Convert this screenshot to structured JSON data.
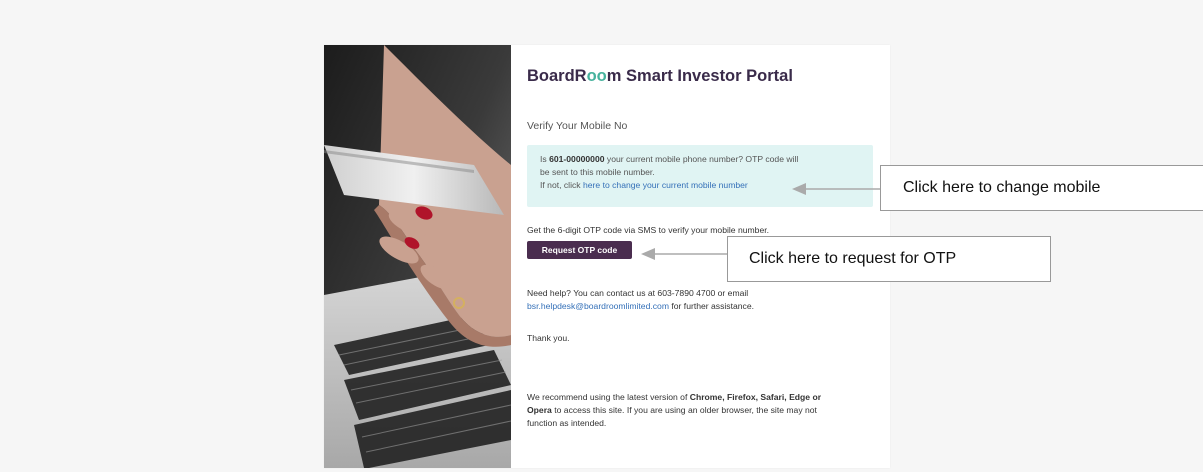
{
  "portal": {
    "brand_part1": "BoardR",
    "brand_accent": "oo",
    "brand_part2": "m Smart Investor Portal",
    "subtitle": "Verify Your Mobile No"
  },
  "info_box": {
    "line1_pre": "Is ",
    "phone": "601-00000000",
    "line1_post": " your current mobile phone number? OTP code will",
    "line2": "be sent to this mobile number.",
    "line3_pre": "If not, click ",
    "change_link": "here to change your current mobile number"
  },
  "otp": {
    "instruction": "Get the 6-digit OTP code via SMS to verify your mobile number.",
    "button_label": "Request OTP code"
  },
  "help": {
    "line1": "Need help? You can contact us at 603-7890 4700 or email",
    "email": "bsr.helpdesk@boardroomlimited.com",
    "line2_post": " for further assistance.",
    "thanks": "Thank you."
  },
  "browser_note": {
    "l1_pre": "We recommend using the latest version of ",
    "l1_bold": "Chrome, Firefox, Safari, Edge or",
    "l2_bold": "Opera",
    "l2_post": " to access this site. If you are using an older browser, the site may not",
    "l3": "function as intended."
  },
  "annotations": {
    "change_mobile": "Click here to change mobile",
    "request_otp": "Click here to request for OTP"
  },
  "colors": {
    "brand_dark": "#3a2b4a",
    "brand_accent": "#46b29d",
    "button_bg": "#4a2d4f",
    "info_bg": "#e0f4f3",
    "link": "#3470b8"
  },
  "icons": {
    "photo": "hand-holding-phone-over-laptop-photo",
    "arrow": "left-pointing-arrow-icon"
  }
}
